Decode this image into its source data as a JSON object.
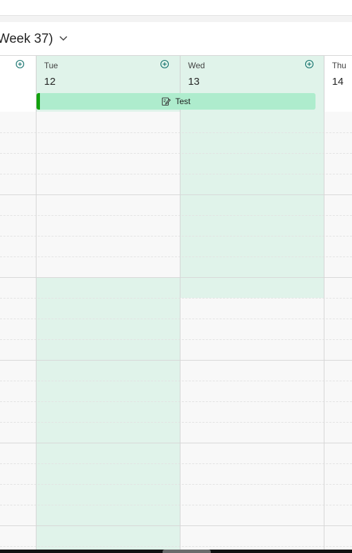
{
  "week": {
    "title": "Week 37)",
    "expand_icon": "chevron-down-icon"
  },
  "days": [
    {
      "name": "",
      "number": "",
      "add_icon": "add-circle-icon"
    },
    {
      "name": "Tue",
      "number": "12",
      "add_icon": "add-circle-icon"
    },
    {
      "name": "Wed",
      "number": "13",
      "add_icon": "add-circle-icon"
    },
    {
      "name": "Thu",
      "number": "14"
    }
  ],
  "event": {
    "title": "Test",
    "icon": "edit-note-icon",
    "color": "#aeeccd",
    "accent": "#13a10e"
  },
  "colors": {
    "highlight": "#e0f3ea",
    "grid_background": "#f8f8f8",
    "add_icon": "#0f6f6a"
  }
}
